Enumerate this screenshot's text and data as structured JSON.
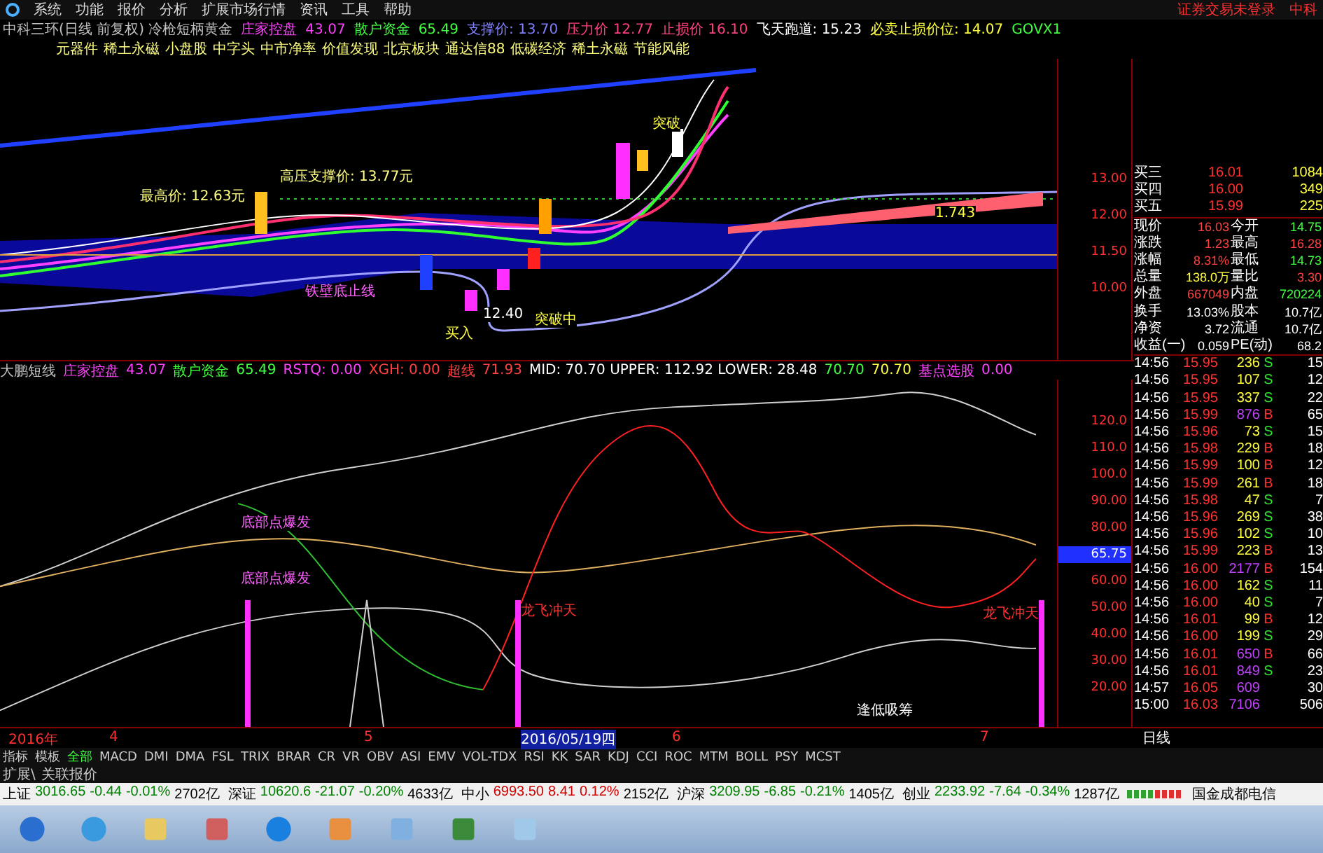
{
  "menu": {
    "items": [
      "系统",
      "功能",
      "报价",
      "分析",
      "扩展市场行情",
      "资讯",
      "工具",
      "帮助"
    ],
    "login": "证券交易未登录",
    "stock_short": "中科"
  },
  "info_line": [
    {
      "text": "中科三环(日线 前复权) 冷枪短柄黄金",
      "color": "#c0c0c0"
    },
    {
      "text": "庄家控盘",
      "color": "#ff40ff"
    },
    {
      "text": "43.07",
      "color": "#ff40ff"
    },
    {
      "text": "散户资金",
      "color": "#40ff40"
    },
    {
      "text": "65.49",
      "color": "#40ff40"
    },
    {
      "text": "支撑价: 13.70",
      "color": "#8080ff"
    },
    {
      "text": "压力价 12.77",
      "color": "#ff4080"
    },
    {
      "text": "止损价 16.10",
      "color": "#ff4080"
    },
    {
      "text": "飞天跑道: 15.23",
      "color": "#ffffff"
    },
    {
      "text": "必卖止损价位: 14.07",
      "color": "#ffff40"
    },
    {
      "text": "GOVX1",
      "color": "#40ff40"
    }
  ],
  "concept_tags": [
    "元器件",
    "稀土永磁",
    "小盘股",
    "中字头",
    "中市净率",
    "价值发现",
    "北京板块",
    "通达信88",
    "低碳经济",
    "稀土永磁",
    "节能风能"
  ],
  "main_chart": {
    "labels": [
      {
        "text": "最高价: 12.63元",
        "kind": "price"
      },
      {
        "text": "高压支撑价:  13.77元",
        "kind": "price"
      },
      {
        "text": "铁壁底止线",
        "kind": "signal"
      },
      {
        "text": "突破中",
        "kind": "buy"
      },
      {
        "text": "12.40",
        "kind": "plain"
      },
      {
        "text": "买入",
        "kind": "buy"
      },
      {
        "text": "突破",
        "kind": "buy"
      },
      {
        "text": "1.743",
        "kind": "buy"
      }
    ],
    "axis": [
      "13.00",
      "12.00",
      "11.50",
      "10.00"
    ]
  },
  "indicator_header": [
    {
      "text": "大鹏短线",
      "color": "#c0c0c0"
    },
    {
      "text": "庄家控盘",
      "color": "#ff40ff"
    },
    {
      "text": "43.07",
      "color": "#ff40ff"
    },
    {
      "text": "散户资金",
      "color": "#40ff40"
    },
    {
      "text": "65.49",
      "color": "#40ff40"
    },
    {
      "text": "RSTQ: 0.00",
      "color": "#ff40ff"
    },
    {
      "text": "XGH: 0.00",
      "color": "#ff4040"
    },
    {
      "text": "超线",
      "color": "#ff4040"
    },
    {
      "text": "71.93",
      "color": "#ff4040"
    },
    {
      "text": "MID: 70.70 UPPER: 112.92 LOWER: 28.48",
      "color": "#ffffff"
    },
    {
      "text": "70.70",
      "color": "#40ff40"
    },
    {
      "text": "70.70",
      "color": "#ffff40"
    },
    {
      "text": "基点选股",
      "color": "#ff40ff"
    },
    {
      "text": "0.00",
      "color": "#ff40ff"
    }
  ],
  "indicator_chart": {
    "labels": [
      {
        "text": "底部点爆发",
        "kind": "signal"
      },
      {
        "text": "底部点爆发",
        "kind": "signal"
      },
      {
        "text": "龙飞冲天",
        "kind": "alert"
      },
      {
        "text": "龙飞冲天",
        "kind": "alert"
      },
      {
        "text": "逢低吸筹",
        "kind": "plain"
      }
    ],
    "axis": [
      {
        "text": "120.0",
        "selected": false
      },
      {
        "text": "110.0",
        "selected": false
      },
      {
        "text": "100.0",
        "selected": false
      },
      {
        "text": "90.00",
        "selected": false
      },
      {
        "text": "80.00",
        "selected": false
      },
      {
        "text": "65.75",
        "selected": true
      },
      {
        "text": "60.00",
        "selected": false
      },
      {
        "text": "50.00",
        "selected": false
      },
      {
        "text": "40.00",
        "selected": false
      },
      {
        "text": "30.00",
        "selected": false
      },
      {
        "text": "20.00",
        "selected": false
      }
    ]
  },
  "date_axis": [
    {
      "text": "2016年",
      "selected": false
    },
    {
      "text": "4",
      "selected": false
    },
    {
      "text": "5",
      "selected": false
    },
    {
      "text": "2016/05/19四",
      "selected": true
    },
    {
      "text": "6",
      "selected": false
    },
    {
      "text": "7",
      "selected": false
    }
  ],
  "period": "日线",
  "indicator_tabs": [
    {
      "label": "指标",
      "selected": false
    },
    {
      "label": "模板",
      "selected": false
    },
    {
      "label": "全部",
      "selected": true
    },
    {
      "label": "MACD",
      "selected": false
    },
    {
      "label": "DMI",
      "selected": false
    },
    {
      "label": "DMA",
      "selected": false
    },
    {
      "label": "FSL",
      "selected": false
    },
    {
      "label": "TRIX",
      "selected": false
    },
    {
      "label": "BRAR",
      "selected": false
    },
    {
      "label": "CR",
      "selected": false
    },
    {
      "label": "VR",
      "selected": false
    },
    {
      "label": "OBV",
      "selected": false
    },
    {
      "label": "ASI",
      "selected": false
    },
    {
      "label": "EMV",
      "selected": false
    },
    {
      "label": "VOL-TDX",
      "selected": false
    },
    {
      "label": "RSI",
      "selected": false
    },
    {
      "label": "KK",
      "selected": false
    },
    {
      "label": "SAR",
      "selected": false
    },
    {
      "label": "KDJ",
      "selected": false
    },
    {
      "label": "CCI",
      "selected": false
    },
    {
      "label": "ROC",
      "selected": false
    },
    {
      "label": "MTM",
      "selected": false
    },
    {
      "label": "BOLL",
      "selected": false
    },
    {
      "label": "PSY",
      "selected": false
    },
    {
      "label": "MCST",
      "selected": false
    }
  ],
  "extension_tabs": [
    "扩展\\",
    "关联报价"
  ],
  "order_book": [
    {
      "label": "买三",
      "price": "16.01",
      "volume": "1084"
    },
    {
      "label": "买四",
      "price": "16.00",
      "volume": "349"
    },
    {
      "label": "买五",
      "price": "15.99",
      "volume": "225"
    }
  ],
  "quote_stats": [
    {
      "label": "现价",
      "value": "16.03",
      "color": "#ff4040"
    },
    {
      "label": "今开",
      "value": "14.75",
      "color": "#40ff40"
    },
    {
      "label": "涨跌",
      "value": "1.23",
      "color": "#ff4040"
    },
    {
      "label": "最高",
      "value": "16.28",
      "color": "#ff4040"
    },
    {
      "label": "涨幅",
      "value": "8.31%",
      "color": "#ff4040"
    },
    {
      "label": "最低",
      "value": "14.73",
      "color": "#40ff40"
    },
    {
      "label": "总量",
      "value": "138.0万",
      "color": "#ffff40"
    },
    {
      "label": "量比",
      "value": "3.30",
      "color": "#ff4040"
    },
    {
      "label": "外盘",
      "value": "667049",
      "color": "#ff4040"
    },
    {
      "label": "内盘",
      "value": "720224",
      "color": "#40ff40"
    },
    {
      "label": "换手",
      "value": "13.03%",
      "color": "#ffffff"
    },
    {
      "label": "股本",
      "value": "10.7亿",
      "color": "#ffffff"
    },
    {
      "label": "净资",
      "value": "3.72",
      "color": "#ffffff"
    },
    {
      "label": "流通",
      "value": "10.7亿",
      "color": "#ffffff"
    },
    {
      "label": "收益(一)",
      "value": "0.059",
      "color": "#ffffff"
    },
    {
      "label": "PE(动)",
      "value": "68.2",
      "color": "#ffffff"
    }
  ],
  "trades": [
    {
      "time": "14:56",
      "price": "15.95",
      "volume": "236",
      "side": "S",
      "count": "15",
      "large": false
    },
    {
      "time": "14:56",
      "price": "15.95",
      "volume": "107",
      "side": "S",
      "count": "12",
      "large": false
    },
    {
      "time": "14:56",
      "price": "15.95",
      "volume": "337",
      "side": "S",
      "count": "22",
      "large": false
    },
    {
      "time": "14:56",
      "price": "15.99",
      "volume": "876",
      "side": "B",
      "count": "65",
      "large": true
    },
    {
      "time": "14:56",
      "price": "15.96",
      "volume": "73",
      "side": "S",
      "count": "15",
      "large": false
    },
    {
      "time": "14:56",
      "price": "15.98",
      "volume": "229",
      "side": "B",
      "count": "18",
      "large": false
    },
    {
      "time": "14:56",
      "price": "15.99",
      "volume": "100",
      "side": "B",
      "count": "12",
      "large": false
    },
    {
      "time": "14:56",
      "price": "15.99",
      "volume": "261",
      "side": "B",
      "count": "18",
      "large": false
    },
    {
      "time": "14:56",
      "price": "15.98",
      "volume": "47",
      "side": "S",
      "count": "7",
      "large": false
    },
    {
      "time": "14:56",
      "price": "15.96",
      "volume": "269",
      "side": "S",
      "count": "38",
      "large": false
    },
    {
      "time": "14:56",
      "price": "15.96",
      "volume": "102",
      "side": "S",
      "count": "10",
      "large": false
    },
    {
      "time": "14:56",
      "price": "15.99",
      "volume": "223",
      "side": "B",
      "count": "13",
      "large": false
    },
    {
      "time": "14:56",
      "price": "16.00",
      "volume": "2177",
      "side": "B",
      "count": "154",
      "large": true
    },
    {
      "time": "14:56",
      "price": "16.00",
      "volume": "162",
      "side": "S",
      "count": "11",
      "large": false
    },
    {
      "time": "14:56",
      "price": "16.00",
      "volume": "40",
      "side": "S",
      "count": "7",
      "large": false
    },
    {
      "time": "14:56",
      "price": "16.01",
      "volume": "99",
      "side": "B",
      "count": "12",
      "large": false
    },
    {
      "time": "14:56",
      "price": "16.00",
      "volume": "199",
      "side": "S",
      "count": "29",
      "large": false
    },
    {
      "time": "14:56",
      "price": "16.01",
      "volume": "650",
      "side": "B",
      "count": "66",
      "large": true
    },
    {
      "time": "14:56",
      "price": "16.01",
      "volume": "849",
      "side": "S",
      "count": "23",
      "large": true
    },
    {
      "time": "14:57",
      "price": "16.05",
      "volume": "609",
      "count": "30",
      "large": true
    },
    {
      "time": "15:00",
      "price": "16.03",
      "volume": "7106",
      "count": "506",
      "large": true
    }
  ],
  "ticker": [
    {
      "name": "上证",
      "value": "3016.65",
      "change": "-0.44",
      "percent": "-0.01%",
      "amount": "2702亿",
      "up": false
    },
    {
      "name": "深证",
      "value": "10620.6",
      "change": "-21.07",
      "percent": "-0.20%",
      "amount": "4633亿",
      "up": false
    },
    {
      "name": "中小",
      "value": "6993.50",
      "change": "8.41",
      "percent": "0.12%",
      "amount": "2152亿",
      "up": true
    },
    {
      "name": "沪深",
      "value": "3209.95",
      "change": "-6.85",
      "percent": "-0.21%",
      "amount": "1405亿",
      "up": false
    },
    {
      "name": "创业",
      "value": "2233.92",
      "change": "-7.64",
      "percent": "-0.34%",
      "amount": "1287亿",
      "up": false
    }
  ],
  "broker": "国金成都电信"
}
